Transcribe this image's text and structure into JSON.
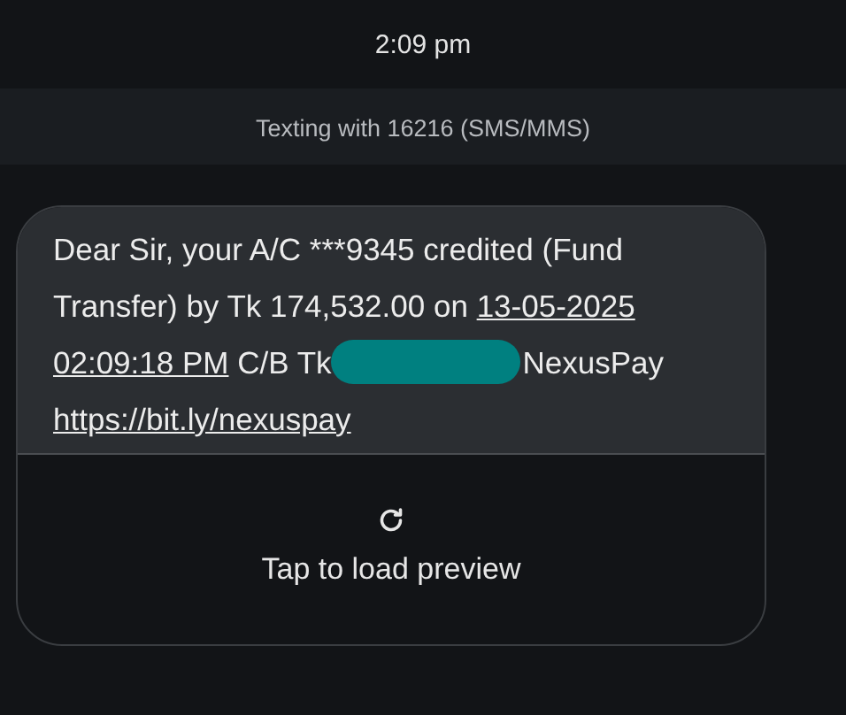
{
  "timestamp": "2:09 pm",
  "conversation_banner": "Texting with 16216 (SMS/MMS)",
  "message": {
    "segments": [
      {
        "kind": "text",
        "text": "Dear Sir, your A/C ***9345 credited (Fund Transfer) by Tk 174,532.00 on "
      },
      {
        "kind": "link",
        "text": "13-05-2025",
        "space_after": true
      },
      {
        "kind": "link",
        "text": "02:09:18 PM"
      },
      {
        "kind": "text",
        "text": " C/B Tk"
      },
      {
        "kind": "redaction"
      },
      {
        "kind": "text",
        "text": "NexusPay "
      },
      {
        "kind": "link",
        "text": "https://bit.ly/nexuspay"
      }
    ],
    "preview": {
      "label": "Tap to load preview"
    }
  }
}
